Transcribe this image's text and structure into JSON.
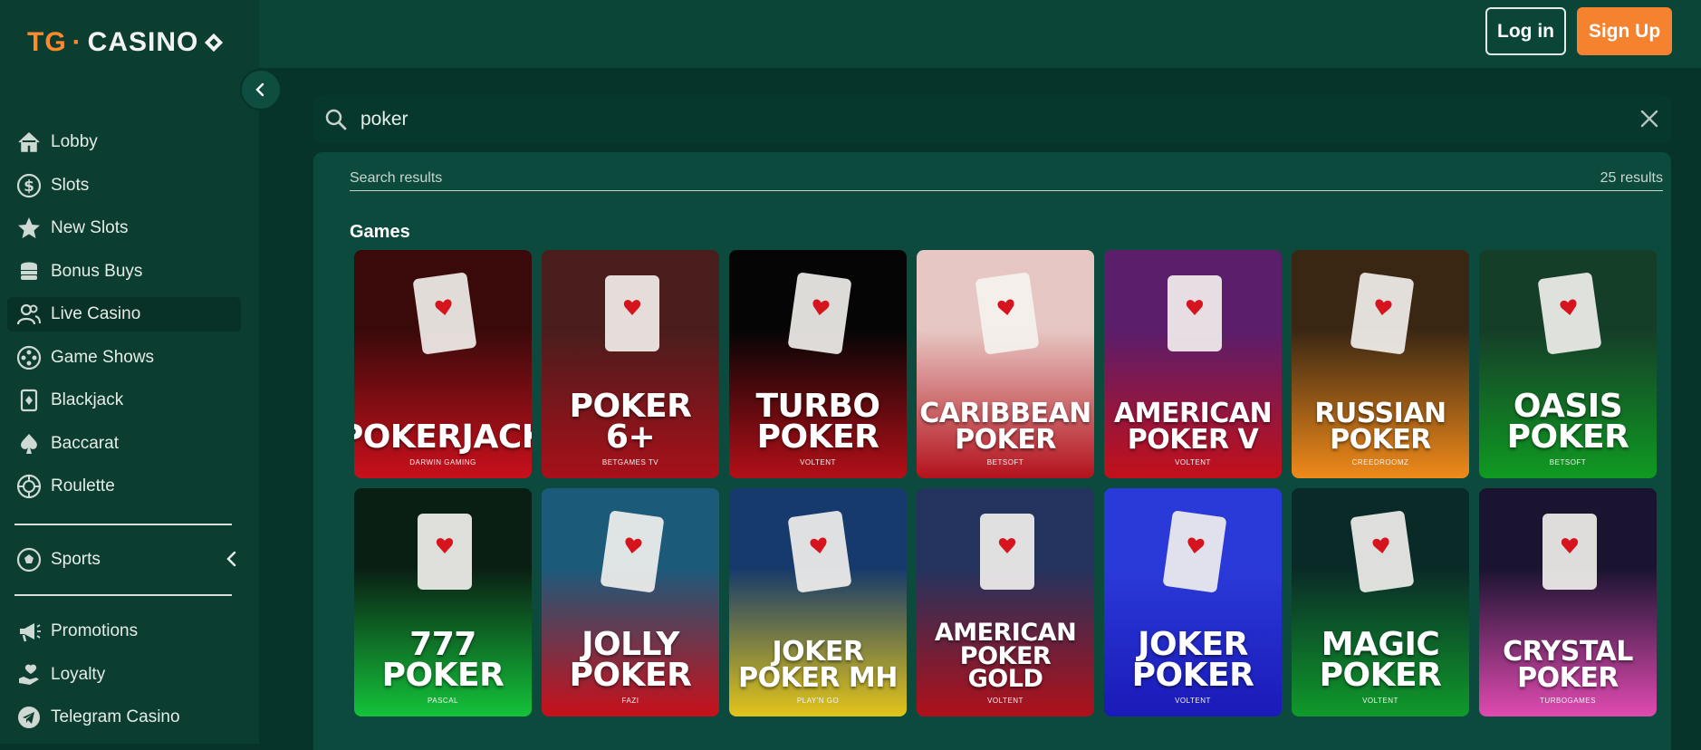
{
  "brand": {
    "logo_prefix": "TG",
    "logo_sep": "·",
    "logo_main": "CASINO"
  },
  "sidebar": {
    "items": [
      {
        "label": "Lobby",
        "icon": "house-icon"
      },
      {
        "label": "Slots",
        "icon": "dollar-circle-icon"
      },
      {
        "label": "New Slots",
        "icon": "star-icon"
      },
      {
        "label": "Bonus Buys",
        "icon": "coins-icon"
      },
      {
        "label": "Live Casino",
        "icon": "people-icon",
        "active": true
      },
      {
        "label": "Game Shows",
        "icon": "film-reel-icon"
      },
      {
        "label": "Blackjack",
        "icon": "playing-card-icon"
      },
      {
        "label": "Baccarat",
        "icon": "spade-icon"
      },
      {
        "label": "Roulette",
        "icon": "roulette-icon"
      }
    ],
    "sports_label": "Sports",
    "items2": [
      {
        "label": "Promotions",
        "icon": "megaphone-icon"
      },
      {
        "label": "Loyalty",
        "icon": "heart-hand-icon"
      },
      {
        "label": "Telegram Casino",
        "icon": "telegram-icon"
      }
    ]
  },
  "header": {
    "login_label": "Log in",
    "signup_label": "Sign Up"
  },
  "search": {
    "value": "poker"
  },
  "results": {
    "label": "Search results",
    "count_text": "25 results",
    "games_heading": "Games",
    "games": [
      {
        "name": "POKERJACK",
        "provider": "DARWIN GAMING",
        "bg": "#c8101c",
        "top": "#3a0a0a"
      },
      {
        "name": "POKER 6+",
        "provider": "BETGAMES TV",
        "bg": "#a8101a",
        "top": "#4a1d1d"
      },
      {
        "name": "TURBO POKER",
        "provider": "VOLTENT",
        "bg": "#b30f18",
        "top": "#050505"
      },
      {
        "name": "CARIBBEAN POKER",
        "provider": "BETSOFT",
        "bg": "#b4121c",
        "top": "#e7c7c3"
      },
      {
        "name": "AMERICAN POKER V",
        "provider": "VOLTENT",
        "bg": "#c3101a",
        "top": "#5a1e6b"
      },
      {
        "name": "RUSSIAN POKER",
        "provider": "CREEDROOMZ",
        "bg": "#f08a1a",
        "top": "#3a2713"
      },
      {
        "name": "OASIS POKER",
        "provider": "BETSOFT",
        "bg": "#0f9a22",
        "top": "#153e28"
      },
      {
        "name": "777 POKER",
        "provider": "PASCAL",
        "bg": "#14c23a",
        "top": "#0a1f14"
      },
      {
        "name": "JOLLY POKER",
        "provider": "FAZI",
        "bg": "#c8101a",
        "top": "#1c5a7a"
      },
      {
        "name": "JOKER POKER MH",
        "provider": "PLAY'N GO",
        "bg": "#e3c51a",
        "top": "#163a6b"
      },
      {
        "name": "AMERICAN POKER GOLD",
        "provider": "VOLTENT",
        "bg": "#b0101a",
        "top": "#23335e"
      },
      {
        "name": "JOKER POKER",
        "provider": "VOLTENT",
        "bg": "#1a1ab8",
        "top": "#2a3ad8"
      },
      {
        "name": "MAGIC POKER",
        "provider": "VOLTENT",
        "bg": "#109a2a",
        "top": "#0a2a28"
      },
      {
        "name": "CRYSTAL POKER",
        "provider": "TURBOGAMES",
        "bg": "#e04ab0",
        "top": "#1a1430"
      }
    ]
  },
  "colors": {
    "accent_orange": "#f4822f",
    "bg_dark_green": "#06332a",
    "panel_green": "#0b4a3c"
  }
}
